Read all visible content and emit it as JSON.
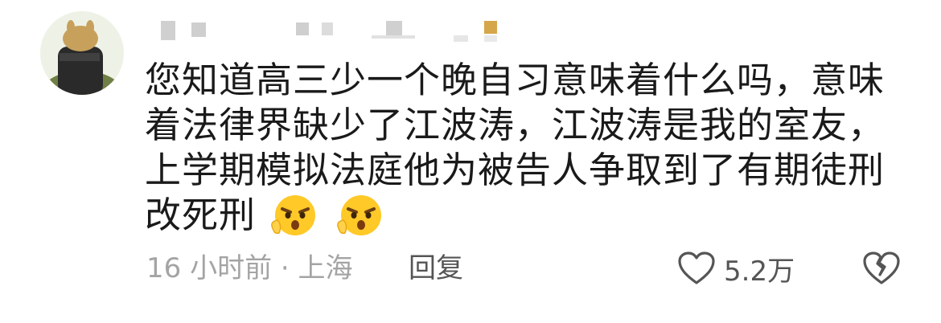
{
  "comment": {
    "content_lines": [
      "您知道高三少一个晚自习意味着什么吗，意味",
      "着法律界缺少了江波涛，江波涛是我的室友，",
      "上学期模拟法庭他为被告人争取到了有期徒刑",
      "改死刑"
    ],
    "emojis": [
      "angry-emoji",
      "angry-emoji"
    ],
    "time_location": "16 小时前 · 上海",
    "reply_label": "回复",
    "likes": "5.2万"
  }
}
